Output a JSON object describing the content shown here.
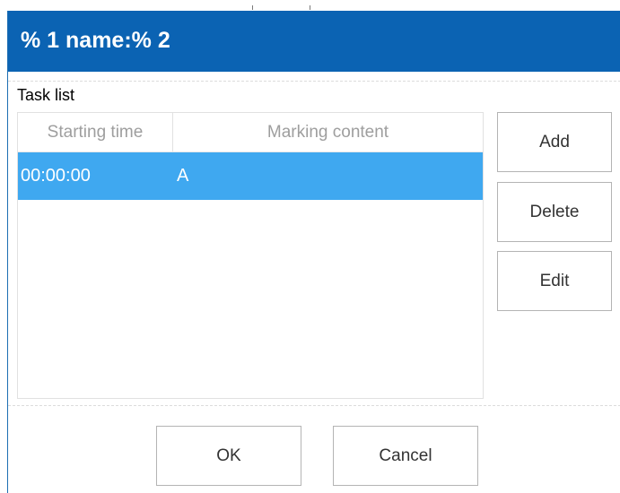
{
  "dialog": {
    "title": "% 1 name:% 2",
    "section_label": "Task list",
    "table": {
      "columns": [
        "Starting time",
        "Marking content"
      ],
      "rows": [
        {
          "starting_time": "00:00:00",
          "marking_content": "A",
          "selected": true
        }
      ]
    },
    "side_buttons": {
      "add": "Add",
      "delete": "Delete",
      "edit": "Edit"
    },
    "footer_buttons": {
      "ok": "OK",
      "cancel": "Cancel"
    }
  },
  "colors": {
    "title_bar": "#0b63b3",
    "selected_row": "#3fa8f0",
    "header_text": "#9e9e9e"
  }
}
